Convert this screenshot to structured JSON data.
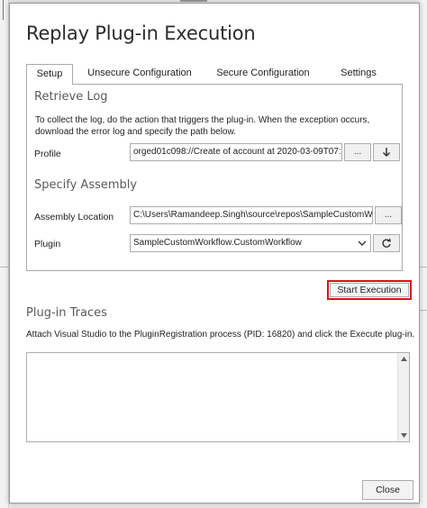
{
  "dialog": {
    "title": "Replay Plug-in Execution"
  },
  "tabs": [
    {
      "label": "Setup",
      "active": true
    },
    {
      "label": "Unsecure Configuration",
      "active": false
    },
    {
      "label": "Secure Configuration",
      "active": false
    },
    {
      "label": "Settings",
      "active": false
    }
  ],
  "retrieve_log": {
    "title": "Retrieve Log",
    "description": "To collect the log, do the action that triggers the plug-in. When the exception occurs, download the error log and specify the path below.",
    "profile_label": "Profile",
    "profile_value": "orged01c098://Create of account at 2020-03-09T07:1",
    "browse_label": "...",
    "download_icon": "download-arrow-icon"
  },
  "specify_assembly": {
    "title": "Specify Assembly",
    "location_label": "Assembly Location",
    "location_value": "C:\\Users\\Ramandeep.Singh\\source\\repos\\SampleCustomWor",
    "browse_label": "...",
    "plugin_label": "Plugin",
    "plugin_value": "SampleCustomWorkflow.CustomWorkflow",
    "refresh_icon": "refresh-icon"
  },
  "actions": {
    "start_label": "Start Execution",
    "highlight_color": "#d9101a"
  },
  "traces": {
    "title": "Plug-in Traces",
    "description": "Attach Visual Studio to the PluginRegistration process (PID: 16820) and click the Execute plug-in."
  },
  "footer": {
    "close_label": "Close"
  }
}
